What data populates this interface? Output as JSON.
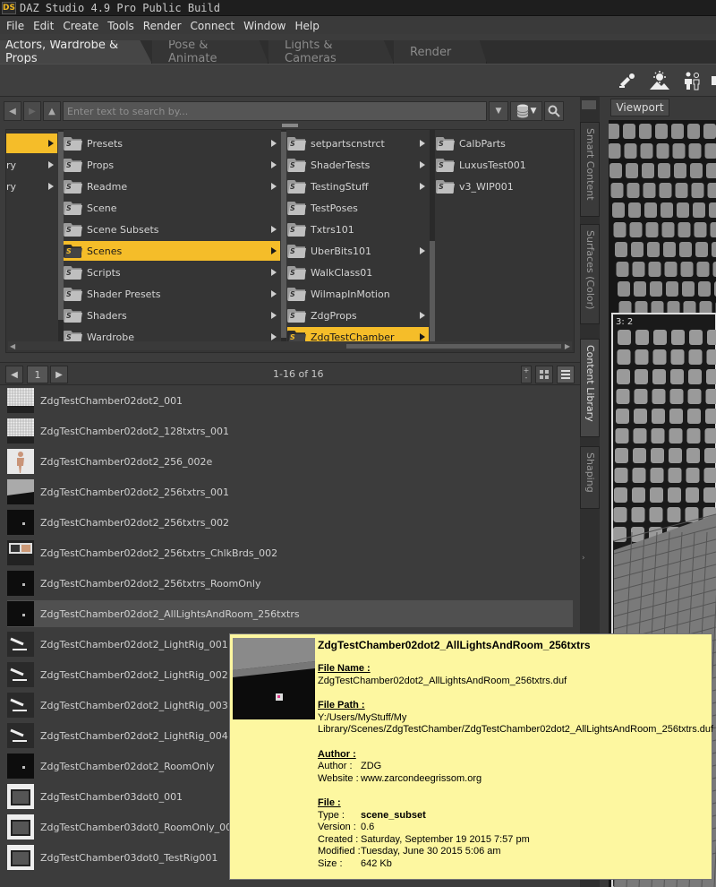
{
  "app": {
    "title": "DAZ Studio 4.9 Pro Public Build",
    "logo": "DS"
  },
  "menu": [
    "File",
    "Edit",
    "Create",
    "Tools",
    "Render",
    "Connect",
    "Window",
    "Help"
  ],
  "top_tabs": [
    {
      "label": "Actors, Wardrobe & Props",
      "active": true
    },
    {
      "label": "Pose & Animate",
      "active": false
    },
    {
      "label": "Lights & Cameras",
      "active": false
    },
    {
      "label": "Render",
      "active": false
    }
  ],
  "search": {
    "placeholder": "Enter text to search by..."
  },
  "browser": {
    "col0": [
      {
        "label": "",
        "selected": true,
        "arrow": true
      },
      {
        "label": "ry",
        "selected": false,
        "arrow": true
      },
      {
        "label": "ry",
        "selected": false,
        "arrow": true
      }
    ],
    "col1": [
      {
        "label": "Presets",
        "selected": false,
        "arrow": true
      },
      {
        "label": "Props",
        "selected": false,
        "arrow": true
      },
      {
        "label": "Readme",
        "selected": false,
        "arrow": true
      },
      {
        "label": "Scene",
        "selected": false,
        "arrow": false
      },
      {
        "label": "Scene Subsets",
        "selected": false,
        "arrow": true
      },
      {
        "label": "Scenes",
        "selected": true,
        "arrow": true
      },
      {
        "label": "Scripts",
        "selected": false,
        "arrow": true
      },
      {
        "label": "Shader Presets",
        "selected": false,
        "arrow": true
      },
      {
        "label": "Shaders",
        "selected": false,
        "arrow": true
      },
      {
        "label": "Wardrobe",
        "selected": false,
        "arrow": true
      }
    ],
    "col2": [
      {
        "label": "setpartscnstrct",
        "selected": false,
        "arrow": true
      },
      {
        "label": "ShaderTests",
        "selected": false,
        "arrow": true
      },
      {
        "label": "TestingStuff",
        "selected": false,
        "arrow": true
      },
      {
        "label": "TestPoses",
        "selected": false,
        "arrow": false
      },
      {
        "label": "Txtrs101",
        "selected": false,
        "arrow": false
      },
      {
        "label": "UberBits101",
        "selected": false,
        "arrow": true
      },
      {
        "label": "WalkClass01",
        "selected": false,
        "arrow": false
      },
      {
        "label": "WilmapInMotion",
        "selected": false,
        "arrow": false
      },
      {
        "label": "ZdgProps",
        "selected": false,
        "arrow": true
      },
      {
        "label": "ZdgTestChamber",
        "selected": true,
        "arrow": true
      }
    ],
    "col3": [
      {
        "label": "CalbParts",
        "selected": false,
        "arrow": false
      },
      {
        "label": "LuxusTest001",
        "selected": false,
        "arrow": false
      },
      {
        "label": "v3_WIP001",
        "selected": false,
        "arrow": false
      }
    ]
  },
  "pager": {
    "page": "1",
    "info": "1-16 of 16"
  },
  "files": [
    {
      "name": "ZdgTestChamber02dot2_001",
      "thumb": "grid"
    },
    {
      "name": "ZdgTestChamber02dot2_128txtrs_001",
      "thumb": "grid"
    },
    {
      "name": "ZdgTestChamber02dot2_256_002e",
      "thumb": "figure"
    },
    {
      "name": "ZdgTestChamber02dot2_256txtrs_001",
      "thumb": "room"
    },
    {
      "name": "ZdgTestChamber02dot2_256txtrs_002",
      "thumb": "dark"
    },
    {
      "name": "ZdgTestChamber02dot2_256txtrs_ChlkBrds_002",
      "thumb": "boards"
    },
    {
      "name": "ZdgTestChamber02dot2_256txtrs_RoomOnly",
      "thumb": "dark"
    },
    {
      "name": "ZdgTestChamber02dot2_AllLightsAndRoom_256txtrs",
      "thumb": "dark"
    },
    {
      "name": "ZdgTestChamber02dot2_LightRig_001",
      "thumb": "rig"
    },
    {
      "name": "ZdgTestChamber02dot2_LightRig_002",
      "thumb": "rig"
    },
    {
      "name": "ZdgTestChamber02dot2_LightRig_003",
      "thumb": "rig"
    },
    {
      "name": "ZdgTestChamber02dot2_LightRig_004",
      "thumb": "rig"
    },
    {
      "name": "ZdgTestChamber02dot2_RoomOnly",
      "thumb": "dark"
    },
    {
      "name": "ZdgTestChamber03dot0_001",
      "thumb": "box"
    },
    {
      "name": "ZdgTestChamber03dot0_RoomOnly_001",
      "thumb": "box"
    },
    {
      "name": "ZdgTestChamber03dot0_TestRig001",
      "thumb": "box"
    }
  ],
  "side_tabs": [
    "Smart Content",
    "Surfaces (Color)",
    "Content Library",
    "Shaping"
  ],
  "viewport": {
    "tab": "Viewport",
    "label": "3: 2"
  },
  "tooltip": {
    "title": "ZdgTestChamber02dot2_AllLightsAndRoom_256txtrs",
    "file_name_head": "File Name :",
    "file_name": "ZdgTestChamber02dot2_AllLightsAndRoom_256txtrs.duf",
    "file_path_head": "File Path :",
    "file_path_1": "Y:/Users/MyStuff/My",
    "file_path_2": "Library/Scenes/ZdgTestChamber/ZdgTestChamber02dot2_AllLightsAndRoom_256txtrs.duf",
    "author_head": "Author :",
    "author_key": "Author :",
    "author": "ZDG",
    "website_key": "Website :",
    "website": "www.zarcondeegrissom.org",
    "file_head": "File :",
    "type_key": "Type :",
    "type": "scene_subset",
    "version_key": "Version :",
    "version": "0.6",
    "created_key": "Created :",
    "created": "Saturday, September 19 2015 7:57 pm",
    "modified_key": "Modified :",
    "modified": "Tuesday, June 30 2015 5:06 am",
    "size_key": "Size :",
    "size": "642 Kb"
  },
  "colors": {
    "accent": "#f5bd29",
    "tooltip_bg": "#fdf7a0",
    "panel_bg": "#3c3c3c"
  }
}
